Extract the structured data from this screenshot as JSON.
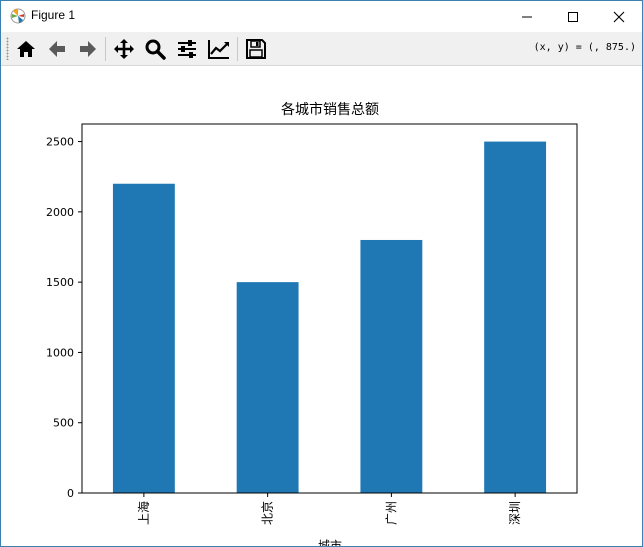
{
  "window": {
    "title": "Figure 1",
    "controls": [
      "minimize",
      "maximize",
      "close"
    ]
  },
  "toolbar": {
    "buttons": [
      {
        "name": "home",
        "icon": "home-icon"
      },
      {
        "name": "back",
        "icon": "arrow-left-icon"
      },
      {
        "name": "forward",
        "icon": "arrow-right-icon"
      },
      {
        "name": "pan",
        "icon": "move-icon"
      },
      {
        "name": "zoom",
        "icon": "magnifier-icon"
      },
      {
        "name": "subplots",
        "icon": "sliders-icon"
      },
      {
        "name": "customize",
        "icon": "line-chart-icon"
      },
      {
        "name": "save",
        "icon": "floppy-icon"
      }
    ],
    "coords_text": "(x, y) = (, 875.)"
  },
  "chart_data": {
    "type": "bar",
    "title": "各城市销售总额",
    "xlabel": "城市",
    "ylabel": "",
    "categories": [
      "上海",
      "北京",
      "广州",
      "深圳"
    ],
    "values": [
      2200,
      1500,
      1800,
      2500
    ],
    "ylim": [
      0,
      2625
    ],
    "yticks": [
      0,
      500,
      1000,
      1500,
      2000,
      2500
    ],
    "color": "#1f77b4",
    "grid": false,
    "legend": "none"
  }
}
